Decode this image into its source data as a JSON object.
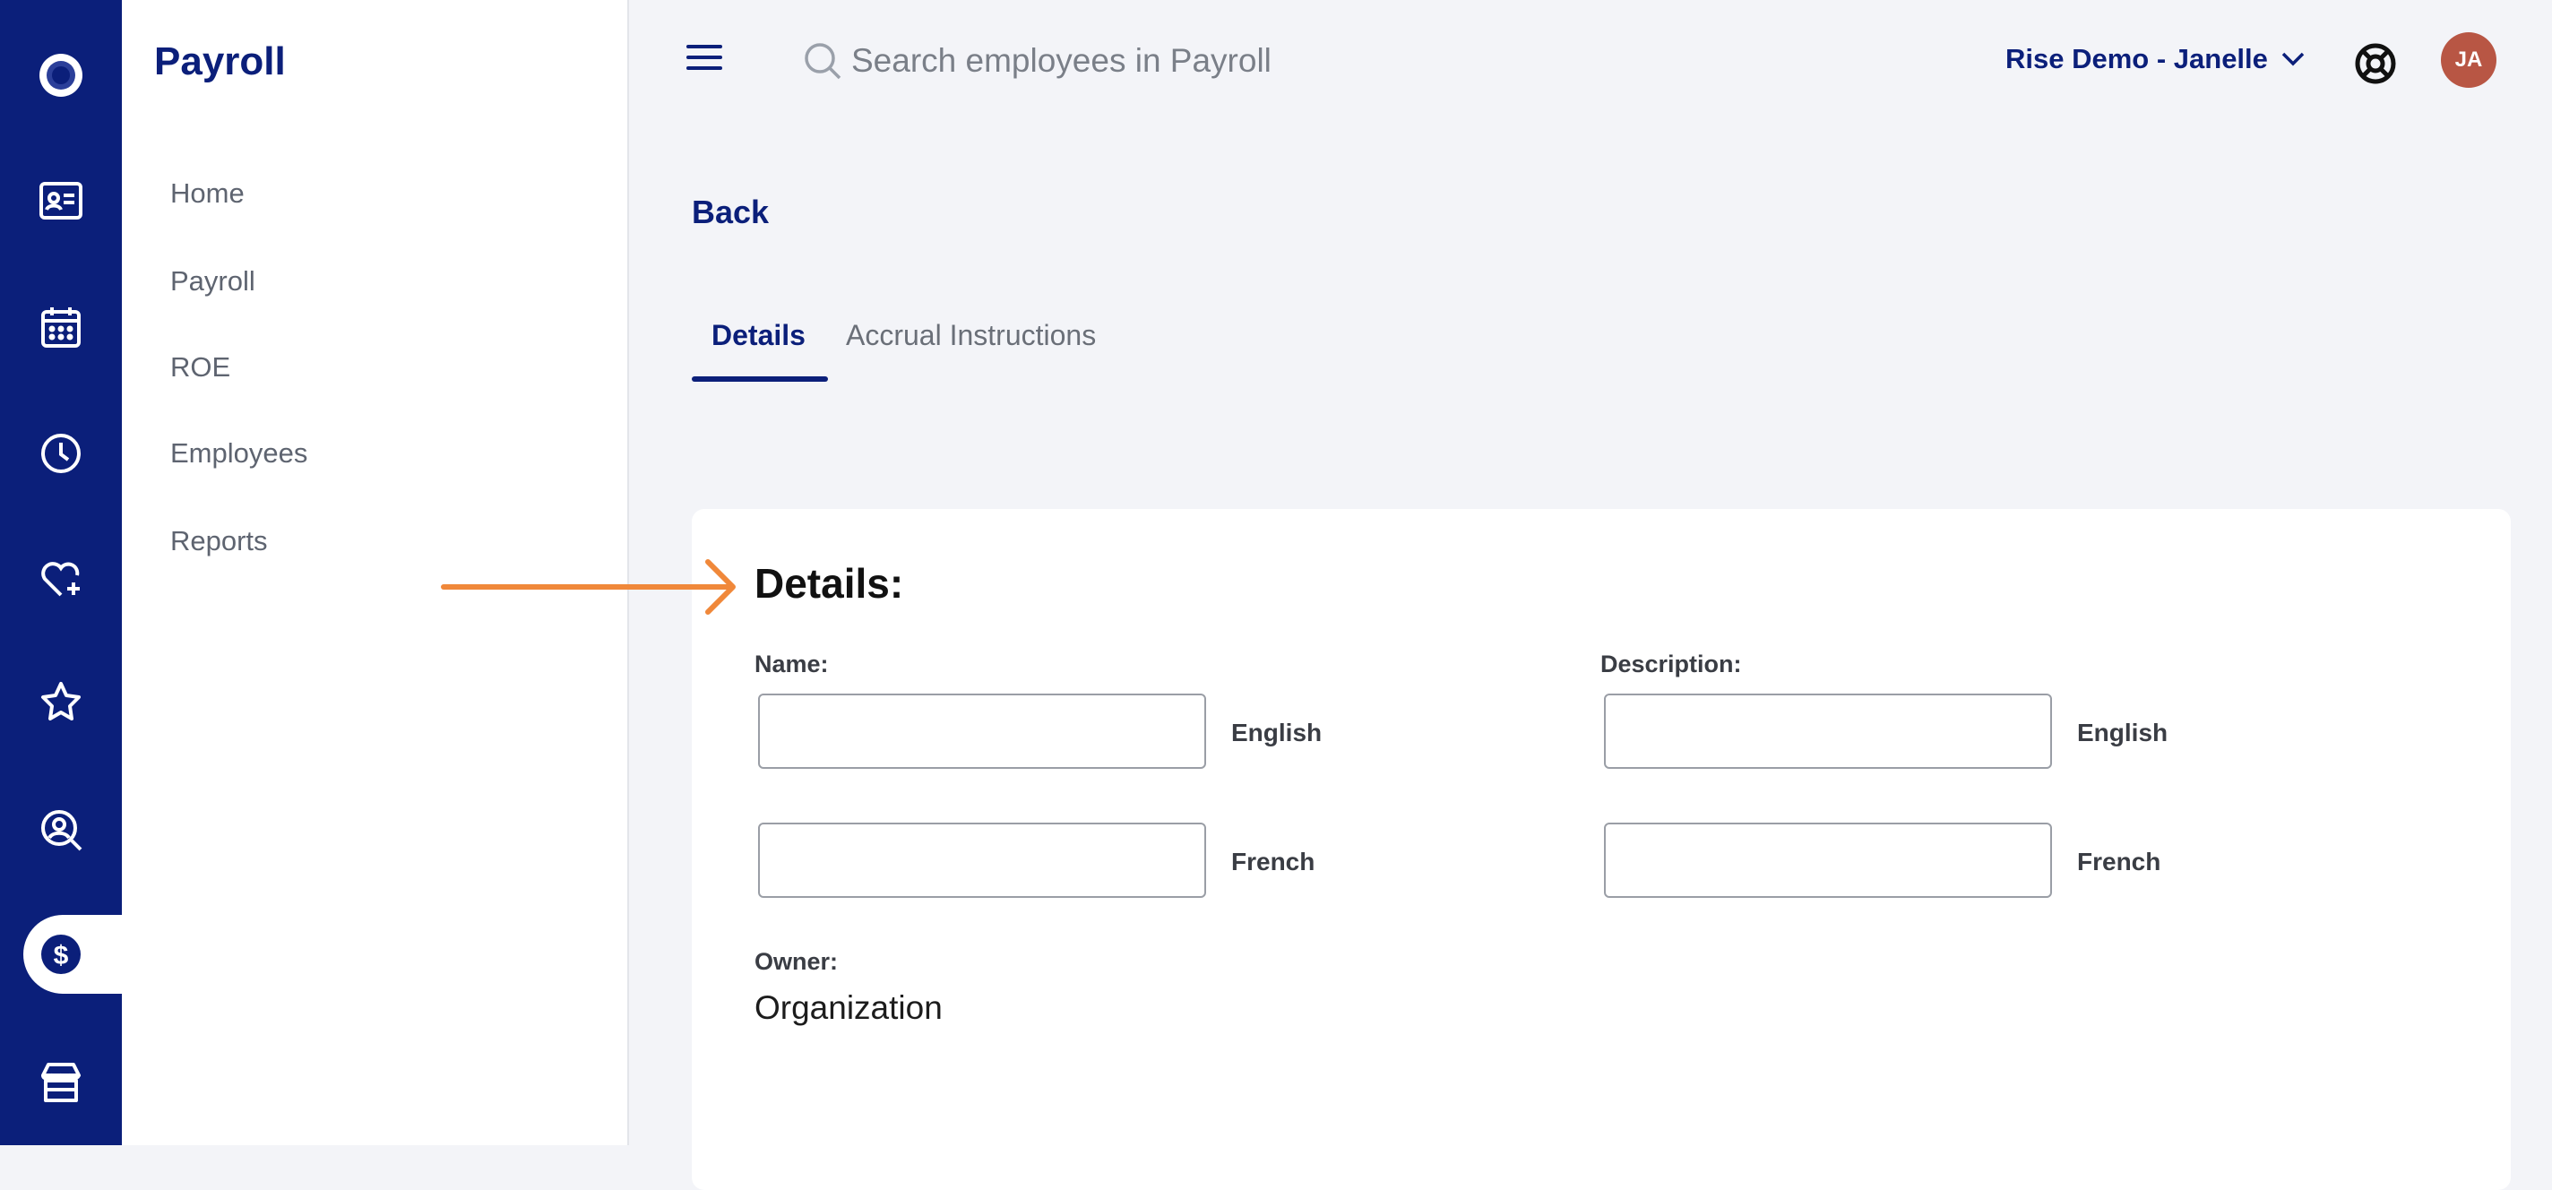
{
  "app": {
    "title": "Payroll"
  },
  "rail": {
    "icons": [
      "logo-icon",
      "employee-card-icon",
      "calendar-icon",
      "clock-icon",
      "heart-plus-icon",
      "star-icon",
      "search-person-icon",
      "dollar-icon",
      "store-icon"
    ],
    "active": "dollar-icon",
    "color": "#0b1f7a"
  },
  "sidebar": {
    "items": [
      {
        "label": "Home"
      },
      {
        "label": "Payroll"
      },
      {
        "label": "ROE"
      },
      {
        "label": "Employees"
      },
      {
        "label": "Reports"
      }
    ]
  },
  "header": {
    "search_placeholder": "Search employees in Payroll",
    "org_label": "Rise Demo - Janelle",
    "avatar_initials": "JA",
    "avatar_color": "#b85644"
  },
  "page": {
    "back_label": "Back",
    "tabs": [
      {
        "label": "Details",
        "active": true
      },
      {
        "label": "Accrual Instructions",
        "active": false
      }
    ]
  },
  "form": {
    "title": "Details:",
    "name_label": "Name:",
    "description_label": "Description:",
    "english_label": "English",
    "french_label": "French",
    "owner_label": "Owner:",
    "owner_value": "Organization",
    "name_english_value": "",
    "name_french_value": "",
    "description_english_value": "",
    "description_french_value": ""
  },
  "annotation": {
    "arrow_color": "#f0883a"
  }
}
